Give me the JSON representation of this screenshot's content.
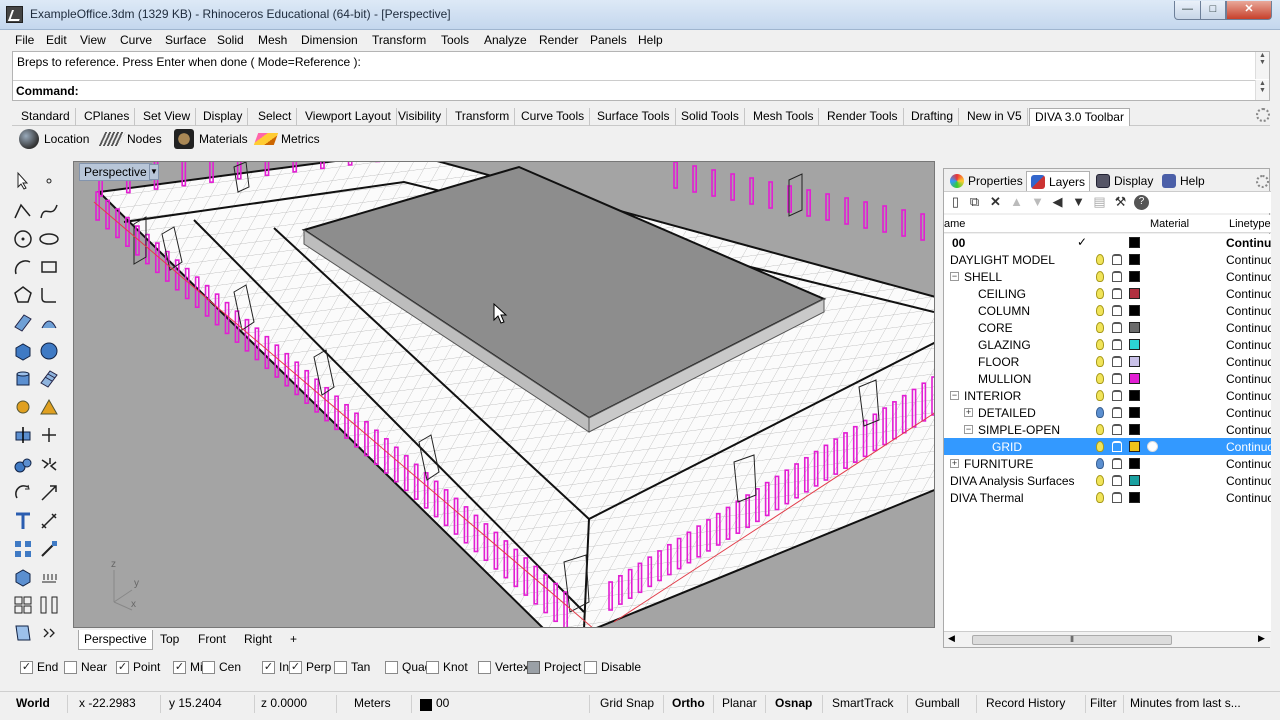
{
  "window": {
    "title": "ExampleOffice.3dm (1329 KB) - Rhinoceros Educational (64-bit) - [Perspective]",
    "min": "—",
    "max": "□",
    "close": "✕"
  },
  "menu": [
    "File",
    "Edit",
    "View",
    "Curve",
    "Surface",
    "Solid",
    "Mesh",
    "Dimension",
    "Transform",
    "Tools",
    "Analyze",
    "Render",
    "Panels",
    "Help"
  ],
  "command": {
    "history": "Breps to reference. Press Enter when done ( Mode=Reference ):",
    "label": "Command:"
  },
  "toolbar_tabs": [
    "Standard",
    "CPlanes",
    "Set View",
    "Display",
    "Select",
    "Viewport Layout",
    "Visibility",
    "Transform",
    "Curve Tools",
    "Surface Tools",
    "Solid Tools",
    "Mesh Tools",
    "Render Tools",
    "Drafting",
    "New in V5",
    "DIVA 3.0 Toolbar"
  ],
  "diva_toolbar": [
    "Location",
    "Nodes",
    "Materials",
    "Metrics"
  ],
  "viewport": {
    "name": "Perspective",
    "axes": {
      "z": "z",
      "y": "y",
      "x": "x"
    },
    "tabs": [
      "Perspective",
      "Top",
      "Front",
      "Right"
    ],
    "add": "+"
  },
  "panel": {
    "tabs": [
      "Properties",
      "Layers",
      "Display",
      "Help"
    ],
    "columns": {
      "name": "ame",
      "material": "Material",
      "linetype": "Linetype"
    },
    "layers": [
      {
        "name": "00",
        "level": 0,
        "bold": true,
        "current": "✓",
        "color": "#000000",
        "linetype": "Continuo"
      },
      {
        "name": "DAYLIGHT MODEL",
        "level": 0,
        "color": "#000000",
        "linetype": "Continuou"
      },
      {
        "name": "SHELL",
        "level": 0,
        "expand": "−",
        "color": "#000000",
        "linetype": "Continuou"
      },
      {
        "name": "CEILING",
        "level": 2,
        "color": "#b03040",
        "linetype": "Continuou"
      },
      {
        "name": "COLUMN",
        "level": 2,
        "color": "#000000",
        "linetype": "Continuou"
      },
      {
        "name": "CORE",
        "level": 2,
        "color": "#6c6c6c",
        "linetype": "Continuou"
      },
      {
        "name": "GLAZING",
        "level": 2,
        "color": "#2cd6d6",
        "linetype": "Continuou"
      },
      {
        "name": "FLOOR",
        "level": 2,
        "color": "#c9c1e8",
        "linetype": "Continuou"
      },
      {
        "name": "MULLION",
        "level": 2,
        "color": "#e21fd3",
        "linetype": "Continuou"
      },
      {
        "name": "INTERIOR",
        "level": 0,
        "expand": "−",
        "color": "#000000",
        "linetype": "Continuou"
      },
      {
        "name": "DETAILED",
        "level": 1,
        "expand": "+",
        "off": true,
        "color": "#000000",
        "linetype": "Continuou"
      },
      {
        "name": "SIMPLE-OPEN",
        "level": 1,
        "expand": "−",
        "color": "#000000",
        "linetype": "Continuou"
      },
      {
        "name": "GRID",
        "level": 3,
        "selected": true,
        "color": "#f0c419",
        "linetype": "Continuou"
      },
      {
        "name": "FURNITURE",
        "level": 0,
        "expand": "+",
        "off": true,
        "color": "#000000",
        "linetype": "Continuou"
      },
      {
        "name": "DIVA Analysis Surfaces",
        "level": 0,
        "color": "#1aa0a0",
        "linetype": "Continuou"
      },
      {
        "name": "DIVA Thermal",
        "level": 0,
        "color": "#000000",
        "linetype": "Continuou"
      }
    ]
  },
  "osnaps": [
    {
      "label": "End",
      "checked": true
    },
    {
      "label": "Near",
      "checked": false
    },
    {
      "label": "Point",
      "checked": true
    },
    {
      "label": "Mid",
      "checked": true
    },
    {
      "label": "Cen",
      "checked": false
    },
    {
      "label": "Int",
      "checked": true
    },
    {
      "label": "Perp",
      "checked": true
    },
    {
      "label": "Tan",
      "checked": false
    },
    {
      "label": "Quad",
      "checked": false
    },
    {
      "label": "Knot",
      "checked": false
    },
    {
      "label": "Vertex",
      "checked": false
    },
    {
      "label": "Project",
      "checked": false,
      "gray": true
    },
    {
      "label": "Disable",
      "checked": false
    }
  ],
  "status": {
    "cplane": "World",
    "x": "x -22.2983",
    "y": "y 15.2404",
    "z": "z 0.0000",
    "units": "Meters",
    "layer": "00",
    "grid_snap": "Grid Snap",
    "ortho": "Ortho",
    "planar": "Planar",
    "osnap": "Osnap",
    "smarttrack": "SmartTrack",
    "gumball": "Gumball",
    "record_history": "Record History",
    "filter": "Filter",
    "info": "Minutes from last s..."
  },
  "colors": {
    "mullion": "#e21fd3",
    "viewport_bg": "#a4a4a4",
    "selection": "#3399ff"
  }
}
